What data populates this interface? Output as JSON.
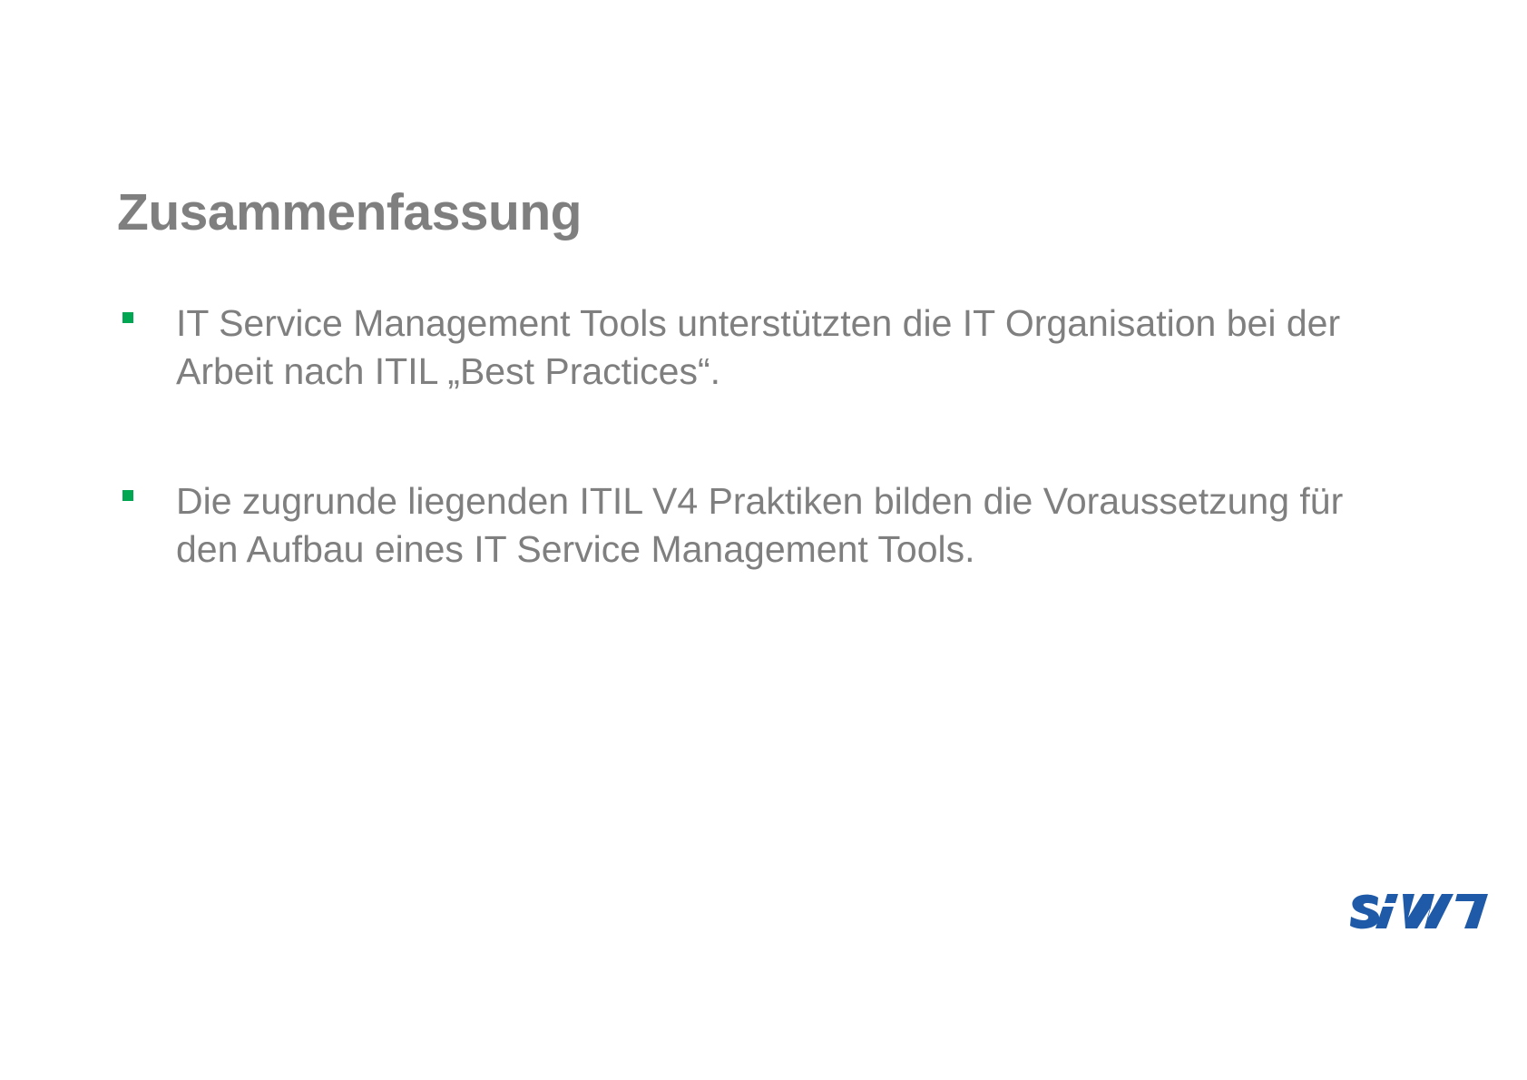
{
  "slide": {
    "title": "Zusammenfassung",
    "bullets": [
      {
        "text": "IT Service Management Tools unterstützten die IT Organisation bei der Arbeit nach ITIL „Best Practices“."
      },
      {
        "text": "Die zugrunde liegenden ITIL V4 Praktiken bilden die Voraussetzung für den Aufbau eines IT Service Management Tools."
      }
    ]
  },
  "logo": {
    "text": "SIW",
    "color": "#1f5aa8"
  },
  "colors": {
    "text": "#7f7f7f",
    "bullet": "#00a651",
    "background": "#ffffff"
  }
}
